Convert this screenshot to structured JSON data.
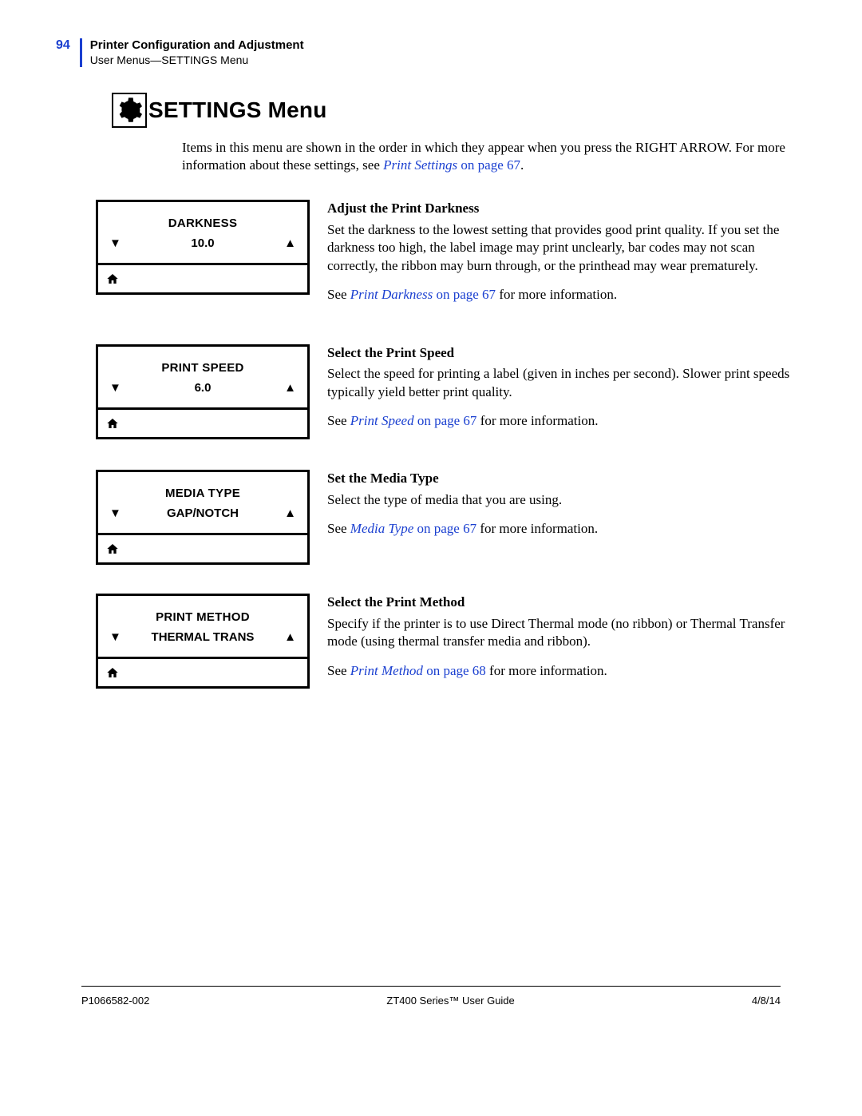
{
  "header": {
    "page_number": "94",
    "title": "Printer Configuration and Adjustment",
    "subtitle": "User Menus—SETTINGS Menu"
  },
  "section": {
    "title": "SETTINGS Menu",
    "intro_pre": "Items in this menu are shown in the order in which they appear when you press the RIGHT ARROW. For more information about these settings, see ",
    "intro_link_italic": "Print Settings",
    "intro_link_plain": " on page 67",
    "intro_post": "."
  },
  "items": [
    {
      "panel_label": "DARKNESS",
      "panel_value": "10.0",
      "title": "Adjust the Print Darkness",
      "body": "Set the darkness to the lowest setting that provides good print quality. If you set the darkness too high, the label image may print unclearly, bar codes may not scan correctly, the ribbon may burn through, or the printhead may wear prematurely.",
      "see_pre": "See ",
      "see_link_italic": "Print Darkness",
      "see_link_plain": " on page 67",
      "see_post": " for more information."
    },
    {
      "panel_label": "PRINT SPEED",
      "panel_value": "6.0",
      "title": "Select the Print Speed",
      "body": "Select the speed for printing a label (given in inches per second). Slower print speeds typically yield better print quality.",
      "see_pre": "See ",
      "see_link_italic": "Print Speed",
      "see_link_plain": " on page 67",
      "see_post": " for more information."
    },
    {
      "panel_label": "MEDIA TYPE",
      "panel_value": "GAP/NOTCH",
      "title": "Set the Media Type",
      "body": "Select the type of media that you are using.",
      "see_pre": "See ",
      "see_link_italic": "Media Type",
      "see_link_plain": " on page 67",
      "see_post": " for more information."
    },
    {
      "panel_label": "PRINT METHOD",
      "panel_value": "THERMAL TRANS",
      "title": "Select the Print Method",
      "body": "Specify if the printer is to use Direct Thermal mode (no ribbon) or Thermal Transfer mode (using thermal transfer media and ribbon).",
      "see_pre": "See ",
      "see_link_italic": "Print Method",
      "see_link_plain": " on page 68",
      "see_post": " for more information."
    }
  ],
  "footer": {
    "left": "P1066582-002",
    "center": "ZT400 Series™ User Guide",
    "right": "4/8/14"
  },
  "glyphs": {
    "down": "▼",
    "up": "▲"
  }
}
